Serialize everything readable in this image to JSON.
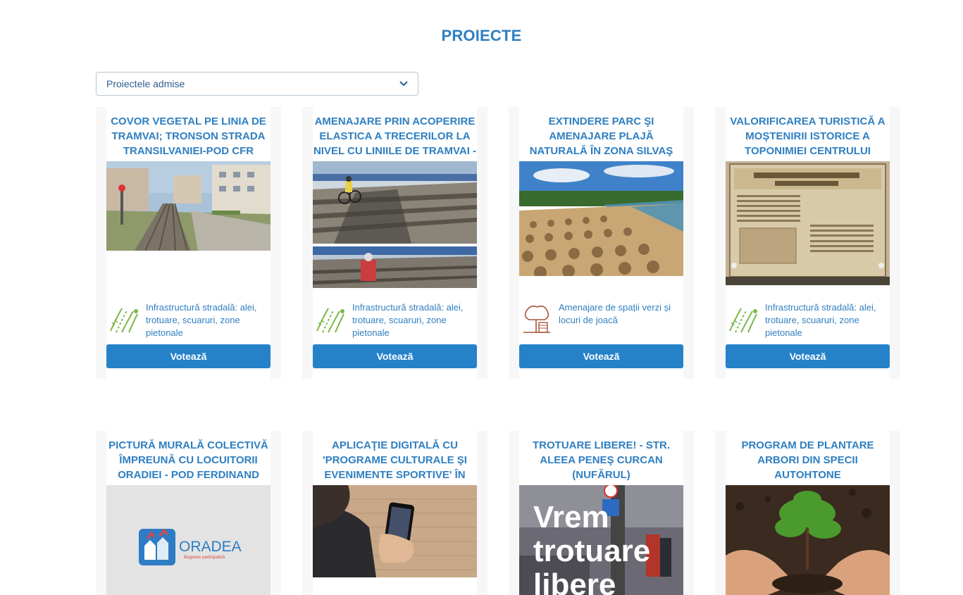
{
  "page": {
    "title": "PROIECTE"
  },
  "filter": {
    "selected": "Proiectele admise",
    "icon": "chevron-down-icon"
  },
  "projects": [
    {
      "title": "COVOR VEGETAL PE LINIA DE TRAMVAI; TRONSON STRADA TRANSILVANIEI-POD CFR",
      "category": "Infrastructură stradală: alei, trotuare, scuaruri, zone pietonale",
      "category_icon": "street-infrastructure-icon",
      "vote_label": "Votează"
    },
    {
      "title": "AMENAJARE PRIN ACOPERIRE ELASTICA A TRECERILOR LA NIVEL CU LINIILE DE TRAMVAI -",
      "category": "Infrastructură stradală: alei, trotuare, scuaruri, zone pietonale",
      "category_icon": "street-infrastructure-icon",
      "vote_label": "Votează"
    },
    {
      "title": "EXTINDERE PARC ŞI AMENAJARE PLAJĂ NATURALĂ ÎN ZONA SILVAŞ",
      "category": "Amenajare de spații verzi și locuri de joacă",
      "category_icon": "green-spaces-icon",
      "vote_label": "Votează"
    },
    {
      "title": "VALORIFICAREA TURISTICĂ A MOŞTENIRII ISTORICE A TOPONIMIEI CENTRULUI",
      "category": "Infrastructură stradală: alei, trotuare, scuaruri, zone pietonale",
      "category_icon": "street-infrastructure-icon",
      "vote_label": "Votează"
    },
    {
      "title": "PICTURĂ MURALĂ COLECTIVĂ ÎMPREUNĂ CU LOCUITORII ORADIEI - POD FERDINAND",
      "logo_text": "ORADEA",
      "logo_subtext": "Bugetare participativă"
    },
    {
      "title": "APLICAŢIE DIGITALĂ CU 'PROGRAME CULTURALE ŞI EVENIMENTE SPORTIVE' ÎN"
    },
    {
      "title": "TROTUARE LIBERE! - STR. ALEEA PENEŞ CURCAN (NUFĂRUL)",
      "image_text": [
        "Vrem",
        "trotuare",
        "libere"
      ]
    },
    {
      "title": "PROGRAM DE PLANTARE ARBORI DIN SPECII AUTOHTONE"
    }
  ]
}
